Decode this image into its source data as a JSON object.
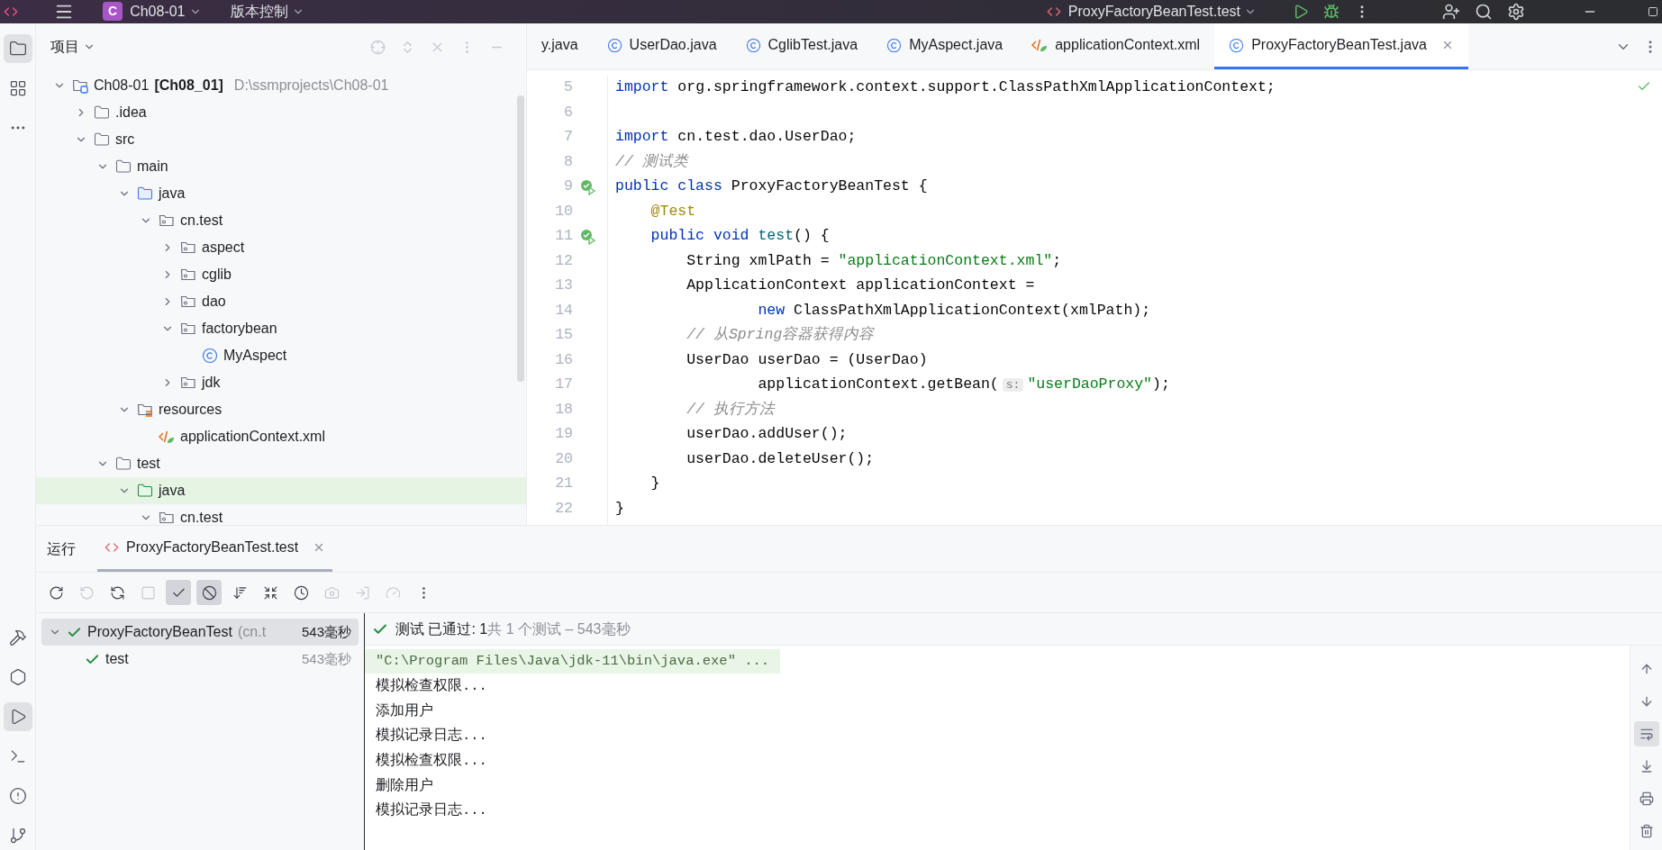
{
  "title_bar": {
    "project_badge": "C",
    "project": "Ch08-01",
    "vcs": "版本控制",
    "run_config": "ProxyFactoryBeanTest.test"
  },
  "tool_strip_top": [
    {
      "kind": "folder",
      "selected": true
    },
    {
      "kind": "structure",
      "selected": false
    },
    {
      "kind": "more",
      "selected": false
    }
  ],
  "tool_strip_bottom": [
    {
      "kind": "build",
      "selected": false
    },
    {
      "kind": "services",
      "selected": false
    },
    {
      "kind": "run",
      "selected": true
    },
    {
      "kind": "terminal",
      "selected": false
    },
    {
      "kind": "problems",
      "selected": false
    },
    {
      "kind": "git",
      "selected": false
    }
  ],
  "project_panel": {
    "title": "项目",
    "tree": [
      {
        "name": "Ch08-01",
        "kind": "module",
        "module_name": "[Ch08_01]",
        "path": "D:\\ssmprojects\\Ch08-01",
        "expanded": true,
        "children": [
          {
            "name": ".idea",
            "kind": "folder",
            "expanded": false
          },
          {
            "name": "src",
            "kind": "folder",
            "expanded": true,
            "children": [
              {
                "name": "main",
                "kind": "folder",
                "expanded": true,
                "children": [
                  {
                    "name": "java",
                    "kind": "source",
                    "expanded": true,
                    "children": [
                      {
                        "name": "cn.test",
                        "kind": "package",
                        "expanded": true,
                        "children": [
                          {
                            "name": "aspect",
                            "kind": "package",
                            "expanded": false
                          },
                          {
                            "name": "cglib",
                            "kind": "package",
                            "expanded": false
                          },
                          {
                            "name": "dao",
                            "kind": "package",
                            "expanded": false
                          },
                          {
                            "name": "factorybean",
                            "kind": "package",
                            "expanded": true,
                            "children": [
                              {
                                "name": "MyAspect",
                                "kind": "class"
                              }
                            ]
                          },
                          {
                            "name": "jdk",
                            "kind": "package",
                            "expanded": false
                          }
                        ]
                      }
                    ]
                  },
                  {
                    "name": "resources",
                    "kind": "resources",
                    "expanded": true,
                    "children": [
                      {
                        "name": "applicationContext.xml",
                        "kind": "xml"
                      }
                    ]
                  }
                ]
              },
              {
                "name": "test",
                "kind": "folder",
                "expanded": true,
                "children": [
                  {
                    "name": "java",
                    "kind": "test-source",
                    "expanded": true,
                    "children": [
                      {
                        "name": "cn.test",
                        "kind": "package",
                        "expanded": true
                      }
                    ]
                  }
                ]
              }
            ]
          }
        ]
      }
    ]
  },
  "editor_tabs": [
    {
      "label": "y.java",
      "kind": "partial",
      "selected": false
    },
    {
      "label": "UserDao.java",
      "kind": "class",
      "selected": false
    },
    {
      "label": "CglibTest.java",
      "kind": "class",
      "selected": false
    },
    {
      "label": "MyAspect.java",
      "kind": "class",
      "selected": false
    },
    {
      "label": "applicationContext.xml",
      "kind": "xml",
      "selected": false
    },
    {
      "label": "ProxyFactoryBeanTest.java",
      "kind": "class",
      "selected": true
    }
  ],
  "code_lines": [
    {
      "number": "5",
      "run": false,
      "segments": [
        {
          "kind": "keyword",
          "text": "import"
        },
        {
          "kind": "plain",
          "text": " org.springframework.context.support.ClassPathXmlApplicationContext;"
        }
      ]
    },
    {
      "number": "6",
      "run": false
    },
    {
      "number": "7",
      "run": false,
      "segments": [
        {
          "kind": "keyword",
          "text": "import"
        },
        {
          "kind": "plain",
          "text": " cn.test.dao.UserDao;"
        }
      ]
    },
    {
      "number": "8",
      "run": false,
      "segments": [
        {
          "kind": "comment",
          "text": "// 测试类"
        }
      ]
    },
    {
      "number": "9",
      "run": true,
      "segments": [
        {
          "kind": "keyword",
          "text": "public class"
        },
        {
          "kind": "plain",
          "text": " ProxyFactoryBeanTest {"
        }
      ]
    },
    {
      "number": "10",
      "run": false,
      "segments": [
        {
          "kind": "annotation",
          "text": "    @Test"
        }
      ]
    },
    {
      "number": "11",
      "run": true,
      "segments": [
        {
          "kind": "keyword",
          "text": "    public void"
        },
        {
          "kind": "method",
          "text": " test"
        },
        {
          "kind": "plain",
          "text": "() {"
        }
      ]
    },
    {
      "number": "12",
      "run": false,
      "segments": [
        {
          "kind": "plain",
          "text": "        String xmlPath = "
        },
        {
          "kind": "string",
          "text": "\"applicationContext.xml\""
        },
        {
          "kind": "plain",
          "text": ";"
        }
      ]
    },
    {
      "number": "13",
      "run": false,
      "segments": [
        {
          "kind": "plain",
          "text": "        ApplicationContext applicationContext ="
        }
      ]
    },
    {
      "number": "14",
      "run": false,
      "segments": [
        {
          "kind": "keyword",
          "text": "                new"
        },
        {
          "kind": "plain",
          "text": " ClassPathXmlApplicationContext(xmlPath);"
        }
      ]
    },
    {
      "number": "15",
      "run": false,
      "segments": [
        {
          "kind": "comment",
          "text": "        // 从Spring容器获得内容"
        }
      ]
    },
    {
      "number": "16",
      "run": false,
      "segments": [
        {
          "kind": "plain",
          "text": "        UserDao userDao = (UserDao)"
        }
      ]
    },
    {
      "number": "17",
      "run": false,
      "segments": [
        {
          "kind": "plain",
          "text": "                applicationContext.getBean("
        },
        {
          "kind": "hint",
          "text": "s:"
        },
        {
          "kind": "string",
          "text": "\"userDaoProxy\""
        },
        {
          "kind": "plain",
          "text": ");"
        }
      ]
    },
    {
      "number": "18",
      "run": false,
      "segments": [
        {
          "kind": "comment",
          "text": "        // 执行方法"
        }
      ]
    },
    {
      "number": "19",
      "run": false,
      "segments": [
        {
          "kind": "plain",
          "text": "        userDao.addUser();"
        }
      ]
    },
    {
      "number": "20",
      "run": false,
      "segments": [
        {
          "kind": "plain",
          "text": "        userDao.deleteUser();"
        }
      ]
    },
    {
      "number": "21",
      "run": false,
      "segments": [
        {
          "kind": "plain",
          "text": "    }"
        }
      ]
    },
    {
      "number": "22",
      "run": false,
      "segments": [
        {
          "kind": "plain",
          "text": "}"
        }
      ]
    }
  ],
  "run_panel": {
    "label": "运行",
    "tab": {
      "label": "ProxyFactoryBeanTest.test",
      "selected": true
    },
    "toolbar": [
      {
        "kind": "rerun",
        "selected": false,
        "disabled": false
      },
      {
        "kind": "rerun-failed",
        "selected": false,
        "disabled": true
      },
      {
        "kind": "toggle-auto",
        "selected": false,
        "disabled": false
      },
      {
        "kind": "stop",
        "selected": false,
        "disabled": true
      },
      {
        "kind": "show-passed",
        "selected": true,
        "disabled": false
      },
      {
        "kind": "show-ignored",
        "selected": true,
        "disabled": false
      },
      {
        "kind": "sort",
        "selected": false,
        "disabled": false
      },
      {
        "kind": "collapse",
        "selected": false,
        "disabled": false
      },
      {
        "kind": "history",
        "selected": false,
        "disabled": false
      },
      {
        "kind": "snapshot",
        "selected": false,
        "disabled": true
      },
      {
        "kind": "import",
        "selected": false,
        "disabled": true
      },
      {
        "kind": "gauge",
        "selected": false,
        "disabled": true
      },
      {
        "kind": "more",
        "selected": false,
        "disabled": false
      }
    ],
    "tests": [
      {
        "name": "ProxyFactoryBeanTest",
        "package": "(cn.t",
        "time": "543毫秒",
        "expanded": true,
        "selected": true,
        "children": [
          {
            "name": "test",
            "time": "543毫秒",
            "selected": false
          }
        ]
      }
    ],
    "status": {
      "passed": "测试 已通过: 1",
      "summary": "共 1 个测试 – 543毫秒"
    },
    "console": [
      {
        "kind": "command",
        "text": "\"C:\\Program Files\\Java\\jdk-11\\bin\\java.exe\" ..."
      },
      {
        "kind": "output",
        "text": "模拟检查权限..."
      },
      {
        "kind": "output",
        "text": "添加用户"
      },
      {
        "kind": "output",
        "text": "模拟记录日志..."
      },
      {
        "kind": "output",
        "text": "模拟检查权限..."
      },
      {
        "kind": "output",
        "text": "删除用户"
      },
      {
        "kind": "output",
        "text": "模拟记录日志..."
      }
    ],
    "console_tools": [
      {
        "kind": "up",
        "selected": false
      },
      {
        "kind": "down",
        "selected": false
      },
      {
        "kind": "wrap",
        "selected": true
      },
      {
        "kind": "scroll-end",
        "selected": false
      },
      {
        "kind": "print",
        "selected": false
      },
      {
        "kind": "clear",
        "selected": false
      }
    ]
  }
}
